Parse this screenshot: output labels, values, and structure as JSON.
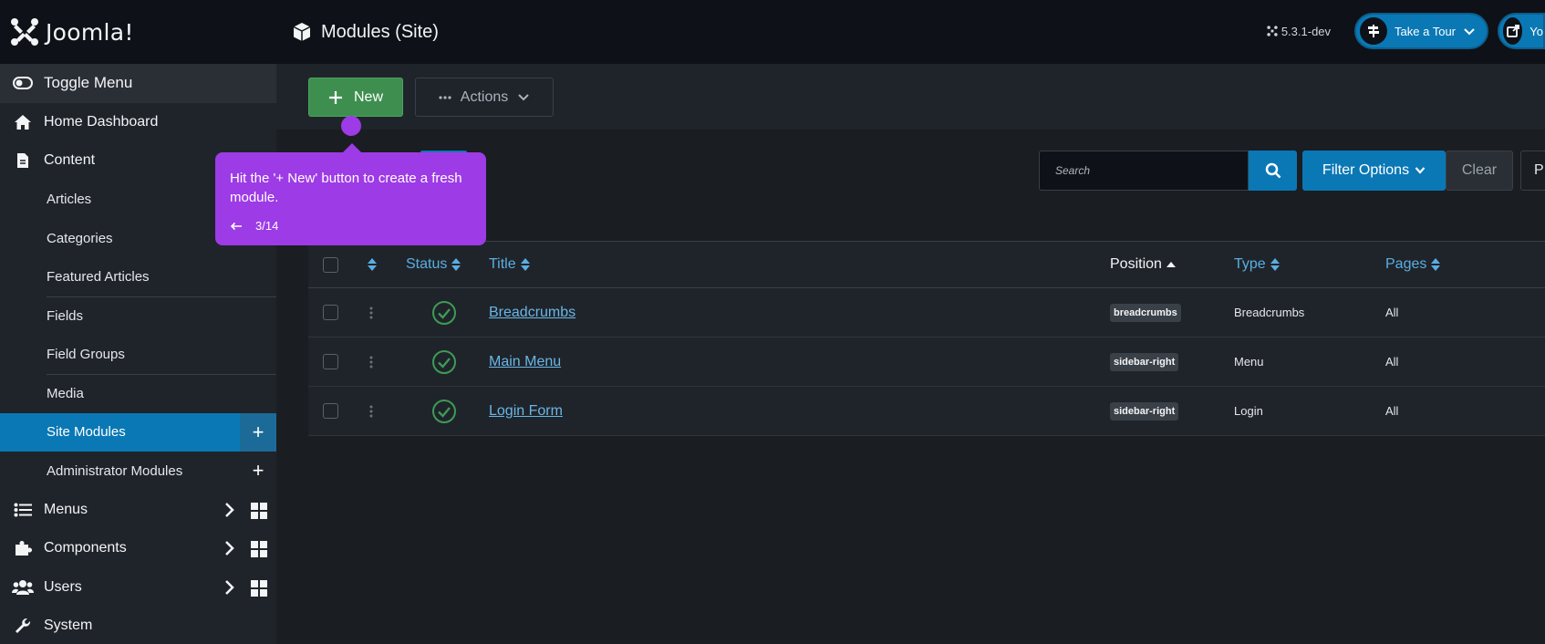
{
  "header": {
    "logo_text": "Joomla!",
    "page_title": "Modules (Site)",
    "version": "5.3.1-dev",
    "tour_label": "Take a Tour",
    "site_label": "Yo"
  },
  "toolbar": {
    "new_label": "New",
    "actions_label": "Actions"
  },
  "sidebar": {
    "toggle_label": "Toggle Menu",
    "items": [
      {
        "label": "Home Dashboard"
      },
      {
        "label": "Content"
      },
      {
        "label": "Articles"
      },
      {
        "label": "Categories"
      },
      {
        "label": "Featured Articles"
      },
      {
        "label": "Fields"
      },
      {
        "label": "Field Groups"
      },
      {
        "label": "Media"
      },
      {
        "label": "Site Modules"
      },
      {
        "label": "Administrator Modules"
      },
      {
        "label": "Menus"
      },
      {
        "label": "Components"
      },
      {
        "label": "Users"
      },
      {
        "label": "System"
      }
    ]
  },
  "filters": {
    "search_placeholder": "Search",
    "filter_options_label": "Filter Options",
    "clear_label": "Clear",
    "extra_label": "P"
  },
  "table": {
    "headers": {
      "status": "Status",
      "title": "Title",
      "position": "Position",
      "type": "Type",
      "pages": "Pages"
    },
    "rows": [
      {
        "title": "Breadcrumbs",
        "position": "breadcrumbs",
        "type": "Breadcrumbs",
        "pages": "All"
      },
      {
        "title": "Main Menu",
        "position": "sidebar-right",
        "type": "Menu",
        "pages": "All"
      },
      {
        "title": "Login Form",
        "position": "sidebar-right",
        "type": "Login",
        "pages": "All"
      }
    ]
  },
  "tooltip": {
    "text": "Hit the '+ New' button to create a fresh module.",
    "step": "3/14"
  },
  "colors": {
    "accent": "#0a78b5",
    "success": "#3e8f4f",
    "tooltip": "#9d3be6"
  }
}
